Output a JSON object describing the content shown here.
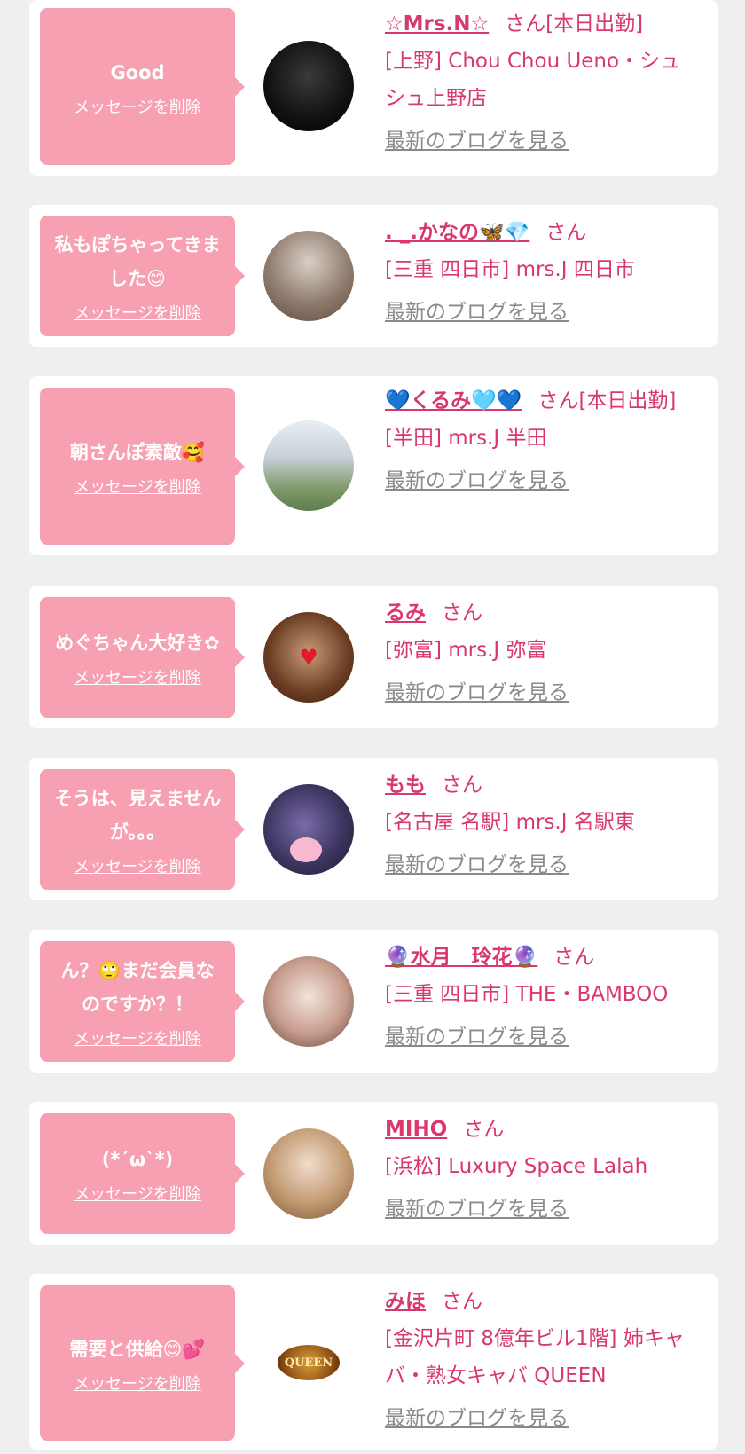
{
  "delete_label": "メッセージを削除",
  "blog_label": "最新のブログを見る",
  "san_label": "さん",
  "entries": [
    {
      "message": "Good",
      "name": "☆Mrs.N☆",
      "suffix": "[本日出勤]",
      "shop": "[上野] Chou Chou Ueno・シュシュ上野店",
      "avatar_icon": "profile-photo-icon"
    },
    {
      "message": "私もぽちゃってきました😊",
      "name": ". _.かなの🦋💎",
      "suffix": "",
      "shop": "[三重 四日市] mrs.J 四日市",
      "avatar_icon": "profile-photo-icon"
    },
    {
      "message": "朝さんぽ素敵🥰",
      "name": "💙くるみ🩵💙",
      "suffix": "[本日出勤]",
      "shop": "[半田] mrs.J 半田",
      "avatar_icon": "profile-photo-icon"
    },
    {
      "message": "めぐちゃん大好き✿",
      "name": "るみ",
      "suffix": "",
      "shop": "[弥富] mrs.J 弥富",
      "avatar_icon": "profile-photo-icon"
    },
    {
      "message": "そうは、見えませんが。。。",
      "name": "もも",
      "suffix": "",
      "shop": "[名古屋 名駅] mrs.J 名駅東",
      "avatar_icon": "profile-photo-icon"
    },
    {
      "message": "ん？🙄まだ会員なのですか？！",
      "name": "🔮水月　玲花🔮",
      "suffix": "",
      "shop": "[三重 四日市] THE・BAMBOO",
      "avatar_icon": "profile-photo-icon"
    },
    {
      "message": "(*´ω`*)",
      "name": "MIHO",
      "suffix": "",
      "shop": "[浜松] Luxury Space Lalah",
      "avatar_icon": "profile-photo-icon"
    },
    {
      "message": "需要と供給😊💕",
      "name": "みほ",
      "suffix": "",
      "shop": "[金沢片町 8億年ビル1階] 姉キャバ・熟女キャバ QUEEN",
      "avatar_icon": "queen-logo-icon",
      "logo_text": "QUEEN"
    }
  ]
}
